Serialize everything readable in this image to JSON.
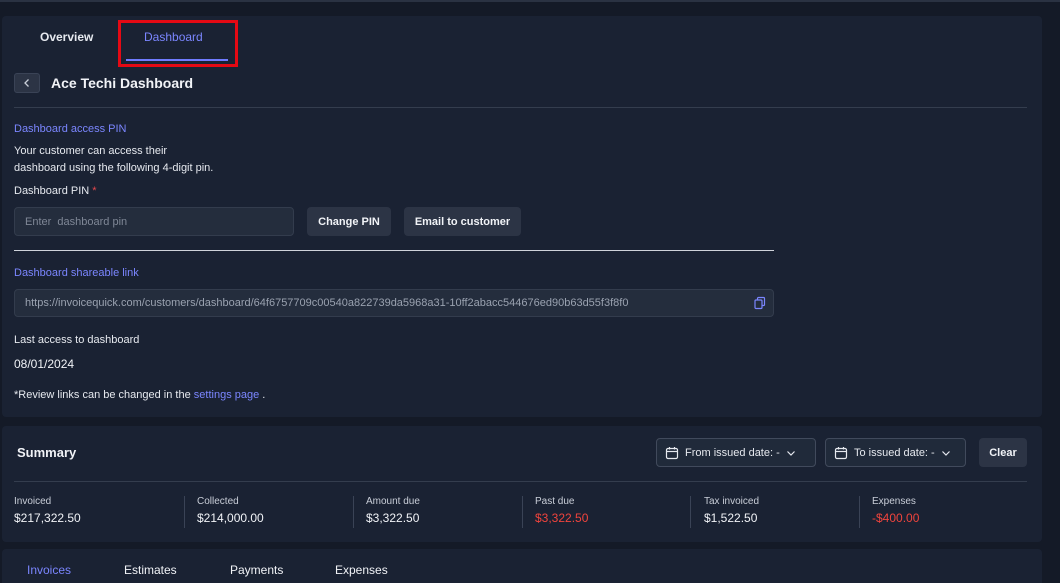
{
  "tabs": {
    "overview": "Overview",
    "dashboard": "Dashboard"
  },
  "header": {
    "title": "Ace Techi Dashboard"
  },
  "pin_section": {
    "heading": "Dashboard access PIN",
    "desc_line1": "Your customer can access their",
    "desc_line2": "dashboard using the following 4-digit pin.",
    "field_label": "Dashboard PIN",
    "required_mark": "*",
    "placeholder": "Enter  dashboard pin",
    "change_pin_label": "Change PIN",
    "email_label": "Email to customer"
  },
  "link_section": {
    "heading": "Dashboard shareable link",
    "url": "https://invoicequick.com/customers/dashboard/64f6757709c00540a822739da5968a31-10ff2abacc544676ed90b63d55f3f8f0"
  },
  "last_access": {
    "label": "Last access to dashboard",
    "date": "08/01/2024"
  },
  "note": {
    "prefix": "*Review links can be changed in the ",
    "link": "settings page",
    "suffix": " ."
  },
  "summary": {
    "title": "Summary",
    "from_filter": "From issued date: -",
    "to_filter": "To issued date: -",
    "clear_label": "Clear",
    "stats": [
      {
        "label": "Invoiced",
        "value": "$217,322.50"
      },
      {
        "label": "Collected",
        "value": "$214,000.00"
      },
      {
        "label": "Amount due",
        "value": "$3,322.50"
      },
      {
        "label": "Past due",
        "value": "$3,322.50"
      },
      {
        "label": "Tax invoiced",
        "value": "$1,522.50"
      },
      {
        "label": "Expenses",
        "value": "-$400.00"
      }
    ]
  },
  "bottom_tabs": {
    "invoices": "Invoices",
    "estimates": "Estimates",
    "payments": "Payments",
    "expenses": "Expenses"
  },
  "colors": {
    "accent": "#7b86ff",
    "negative": "#f0443d",
    "highlight": "#e50914"
  }
}
